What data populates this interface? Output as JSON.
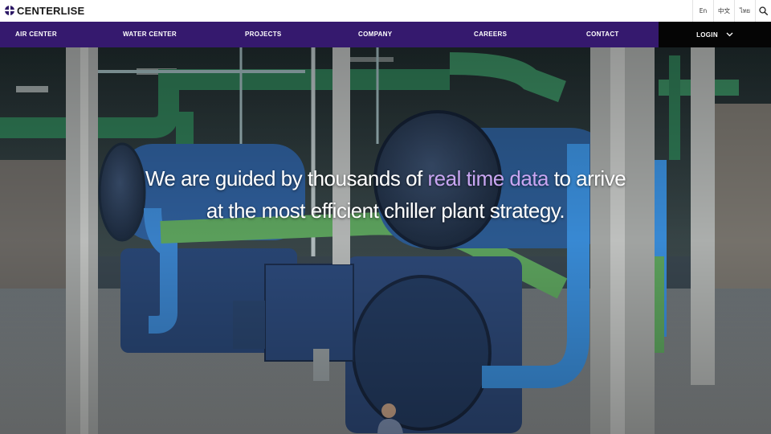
{
  "brand": {
    "name": "CENTERLISE",
    "logo_icon": "globe-icon",
    "color": "#2e1a66"
  },
  "languages": [
    "En",
    "中文",
    "ไทย"
  ],
  "search": {
    "icon": "search-icon"
  },
  "nav": {
    "items": [
      "AIR CENTER",
      "WATER CENTER",
      "PROJECTS",
      "COMPANY",
      "CAREERS",
      "CONTACT"
    ],
    "login_label": "LOGIN",
    "background": "#35196e",
    "login_background": "#050505"
  },
  "hero": {
    "headline_part1": "We are guided by thousands of ",
    "headline_highlight": "real time data",
    "headline_part2": " to arrive",
    "headline_line2": "at the most efficient chiller plant strategy.",
    "highlight_color": "#c9a6f2"
  }
}
